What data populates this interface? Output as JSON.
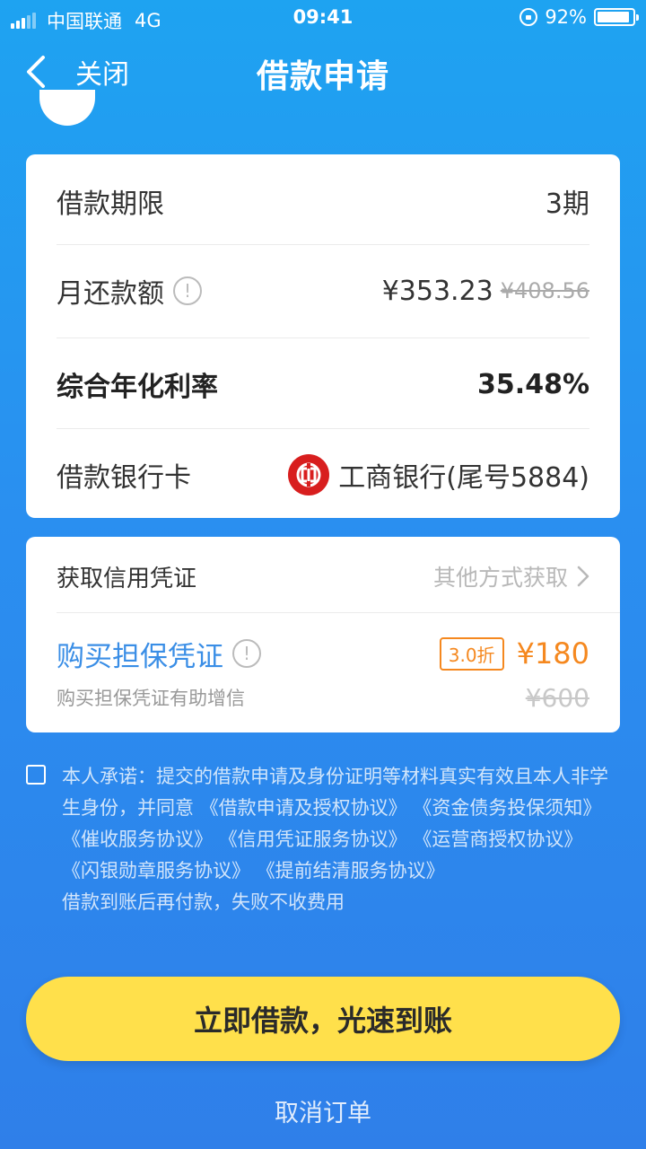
{
  "status_bar": {
    "carrier": "中国联通",
    "network": "4G",
    "time": "09:41",
    "battery": "92%",
    "battery_level": 0.92
  },
  "nav": {
    "back_label": "关闭",
    "title": "借款申请"
  },
  "loan_details": {
    "term_label": "借款期限",
    "term_value": "3期",
    "monthly_label": "月还款额",
    "monthly_value": "¥353.23",
    "monthly_original": "¥408.56",
    "rate_label": "综合年化利率",
    "rate_value": "35.48%",
    "card_label": "借款银行卡",
    "card_value": "工商银行(尾号5884)"
  },
  "credit": {
    "get_label": "获取信用凭证",
    "other_way": "其他方式获取",
    "buy_label": "购买担保凭证",
    "buy_sub": "购买担保凭证有助增信",
    "discount": "3.0折",
    "price": "¥180",
    "original_price": "¥600"
  },
  "agreement": {
    "prefix": "本人承诺：提交的借款申请及身份证明等材料真实有效且本人非学生身份，并同意",
    "docs": [
      "《借款申请及授权协议》",
      "《资金债务投保须知》",
      "《催收服务协议》",
      "《信用凭证服务协议》",
      "《运营商授权协议》",
      "《闪银勋章服务协议》",
      "《提前结清服务协议》"
    ],
    "suffix": "借款到账后再付款，失败不收费用"
  },
  "actions": {
    "submit": "立即借款，光速到账",
    "cancel": "取消订单"
  },
  "colors": {
    "accent_blue": "#3a8ee6",
    "orange": "#f5881f",
    "button_yellow": "#ffe04b",
    "bank_red": "#d81e1e"
  }
}
